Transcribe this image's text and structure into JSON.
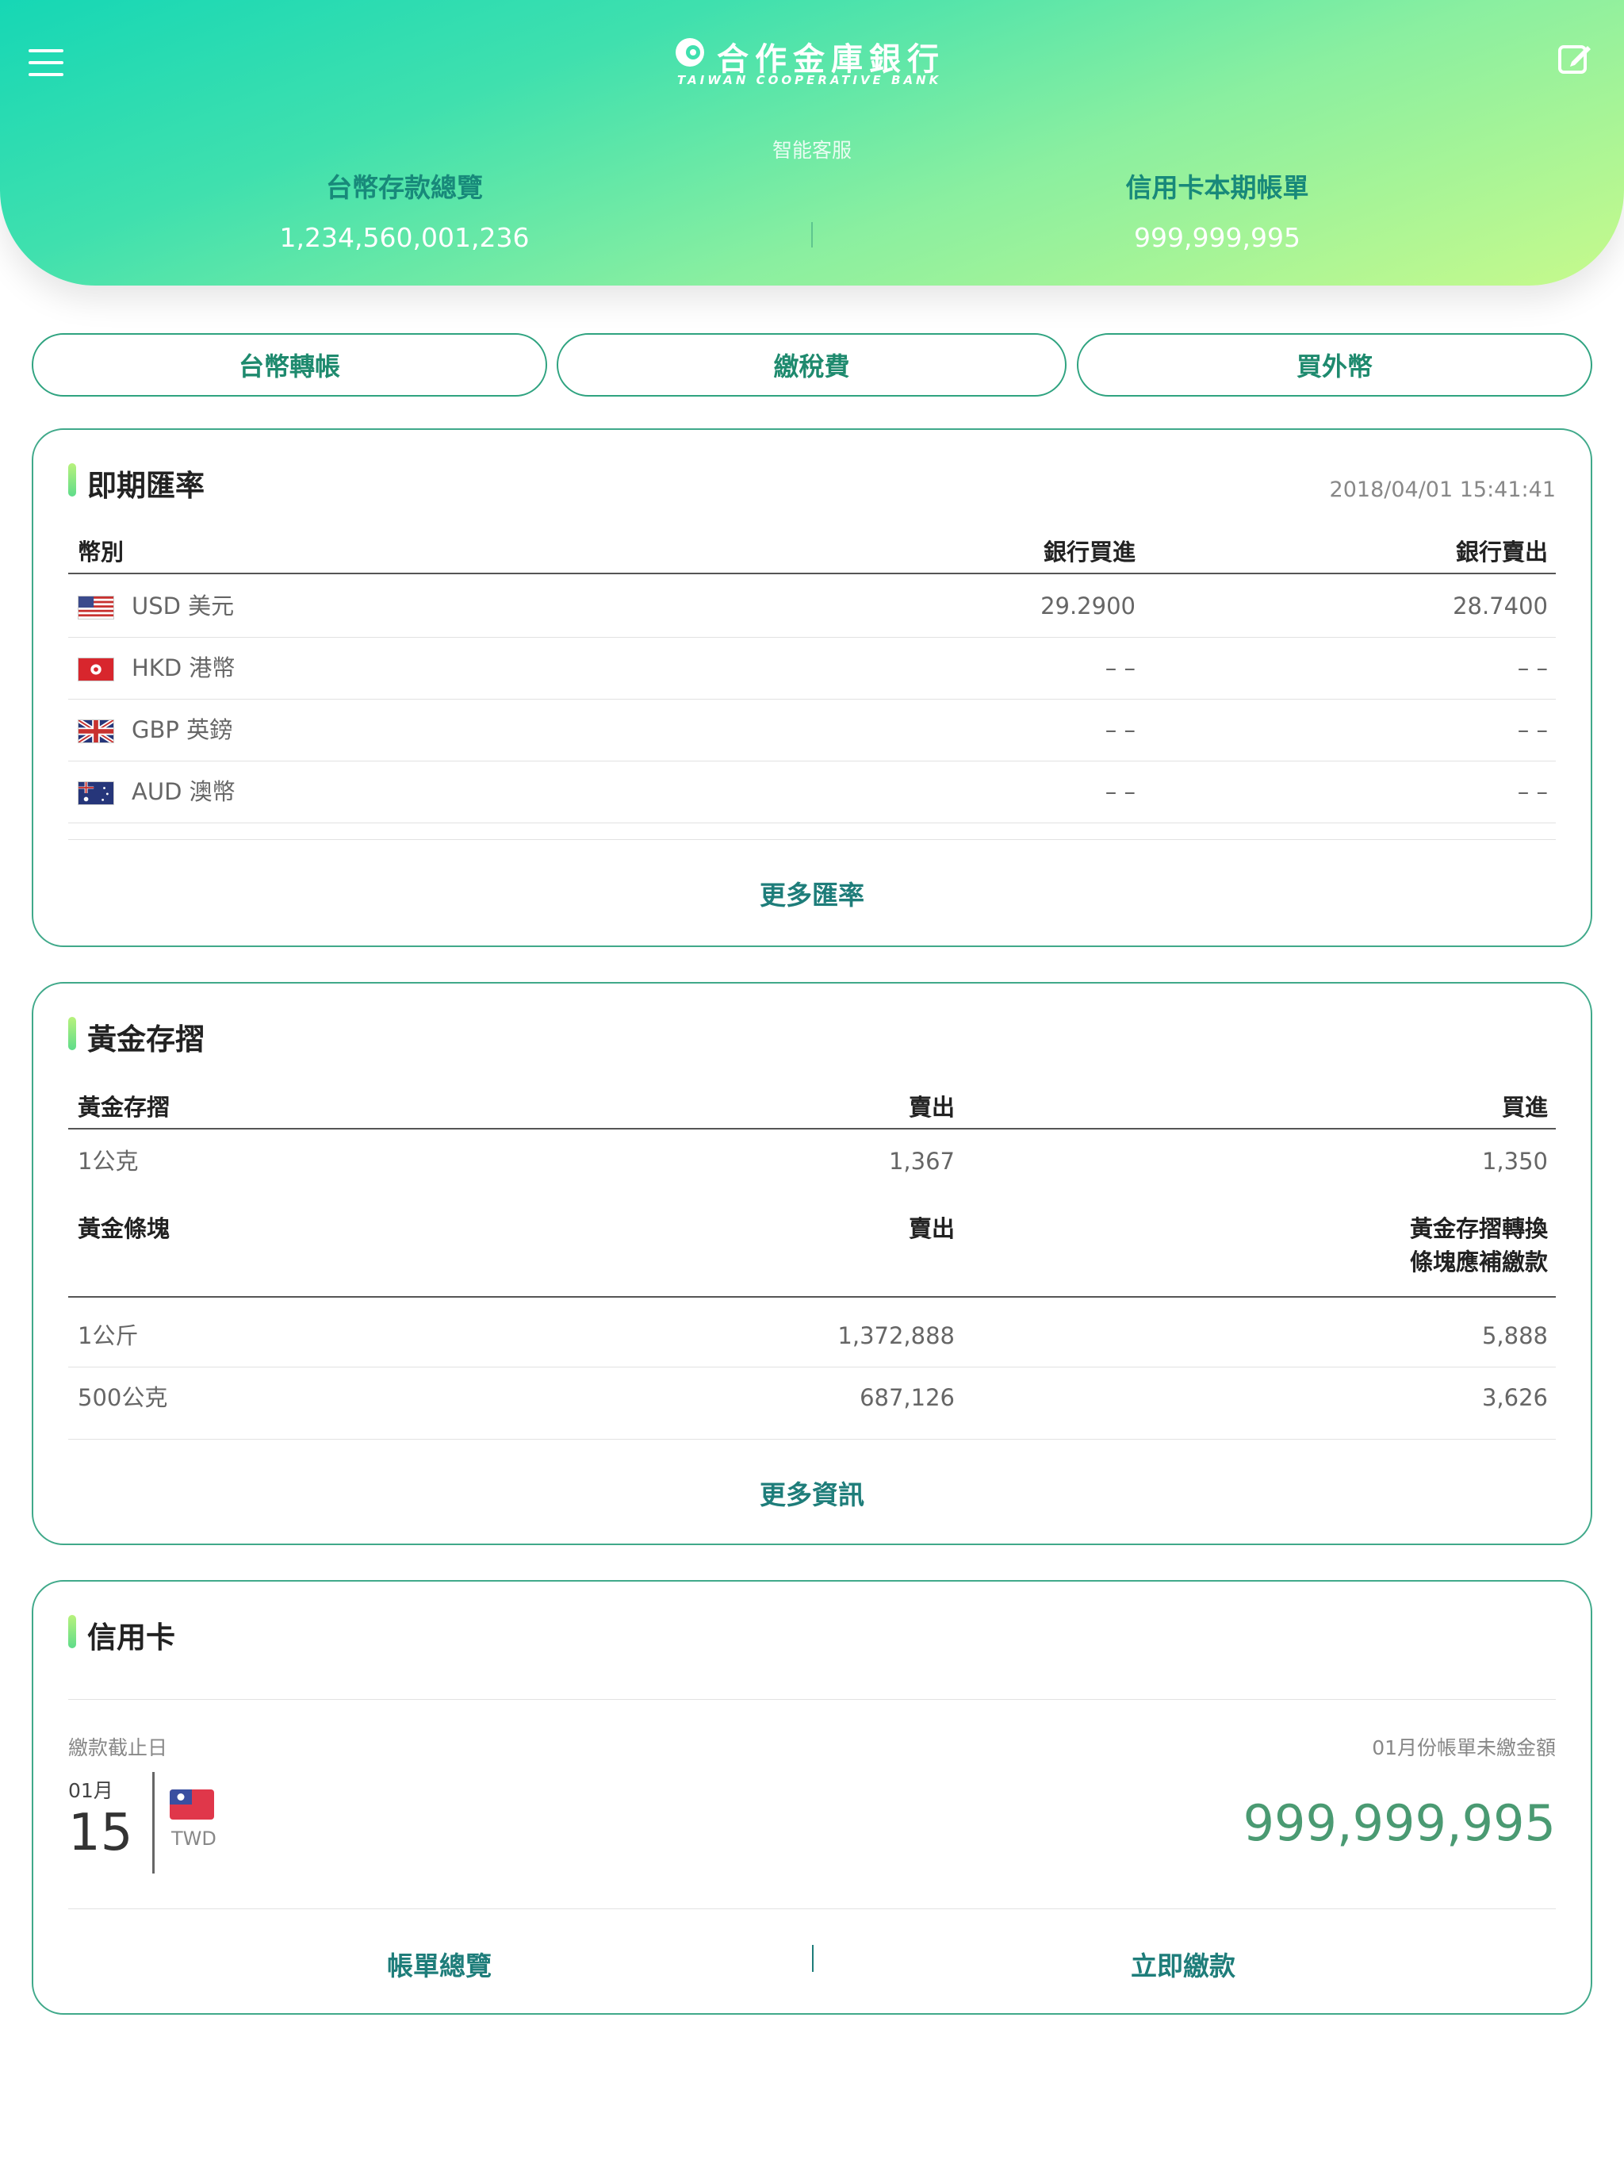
{
  "header": {
    "bank_name_cn": "合作金庫銀行",
    "bank_name_en": "TAIWAN COOPERATIVE BANK",
    "service_link": "智能客服",
    "deposit_label": "台幣存款總覽",
    "deposit_value": "1,234,560,001,236",
    "credit_label": "信用卡本期帳單",
    "credit_value": "999,999,995"
  },
  "quick_actions": [
    "台幣轉帳",
    "繳稅費",
    "買外幣"
  ],
  "exchange": {
    "title": "即期匯率",
    "timestamp": "2018/04/01 15:41:41",
    "headers": {
      "currency": "幣別",
      "buy": "銀行買進",
      "sell": "銀行賣出"
    },
    "rows": [
      {
        "flag": "us-flag-icon",
        "name": "USD 美元",
        "buy": "29.2900",
        "sell": "28.7400"
      },
      {
        "flag": "hk-flag-icon",
        "name": "HKD 港幣",
        "buy": "– –",
        "sell": "– –"
      },
      {
        "flag": "uk-flag-icon",
        "name": "GBP 英鎊",
        "buy": "– –",
        "sell": "– –"
      },
      {
        "flag": "au-flag-icon",
        "name": "AUD 澳幣",
        "buy": "– –",
        "sell": "– –"
      }
    ],
    "more": "更多匯率"
  },
  "gold": {
    "title": "黃金存摺",
    "passbook_headers": {
      "name": "黃金存摺",
      "sell": "賣出",
      "buy": "買進"
    },
    "passbook_rows": [
      {
        "name": "1公克",
        "sell": "1,367",
        "buy": "1,350"
      }
    ],
    "bar_headers": {
      "name": "黃金條塊",
      "sell": "賣出",
      "extra_line1": "黃金存摺轉換",
      "extra_line2": "條塊應補繳款"
    },
    "bar_rows": [
      {
        "name": "1公斤",
        "sell": "1,372,888",
        "extra": "5,888"
      },
      {
        "name": "500公克",
        "sell": "687,126",
        "extra": "3,626"
      }
    ],
    "more": "更多資訊"
  },
  "credit_card": {
    "title": "信用卡",
    "due_label": "繳款截止日",
    "unpaid_label": "01月份帳單未繳金額",
    "due_month": "01月",
    "due_day": "15",
    "currency": "TWD",
    "amount": "999,999,995",
    "bill_link": "帳單總覽",
    "pay_link": "立即繳款"
  },
  "colors": {
    "accent": "#1e7d7a",
    "border": "#40a98a",
    "amount": "#4a9a72"
  }
}
